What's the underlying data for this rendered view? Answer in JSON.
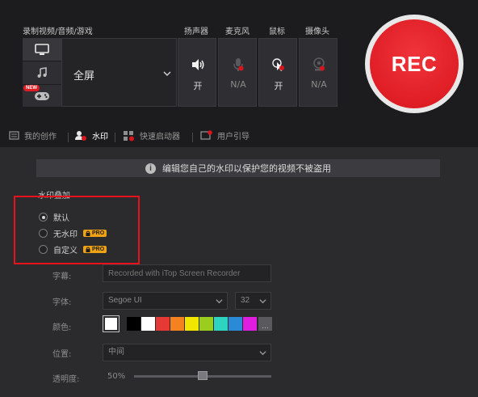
{
  "header": {
    "record_section_label": "录制视频/音频/游戏",
    "speaker_label": "扬声器",
    "mic_label": "麦克风",
    "mouse_label": "鼠标",
    "camera_label": "摄像头"
  },
  "sources": {
    "screen_mode": "全屏",
    "new_badge": "NEW"
  },
  "devices": {
    "speaker_state": "开",
    "mic_state": "N/A",
    "mouse_state": "开",
    "camera_state": "N/A"
  },
  "rec_button": "REC",
  "tabs": [
    {
      "label": "我的创作",
      "icon": "film-icon"
    },
    {
      "label": "水印",
      "icon": "watermark-icon"
    },
    {
      "label": "快速启动器",
      "icon": "launcher-icon"
    },
    {
      "label": "用户引导",
      "icon": "guide-icon"
    }
  ],
  "info_banner": "编辑您自己的水印以保护您的视频不被盗用",
  "watermark": {
    "group_title": "水印叠加",
    "options": [
      {
        "label": "默认",
        "selected": true,
        "pro": false
      },
      {
        "label": "无水印",
        "selected": false,
        "pro": true
      },
      {
        "label": "自定义",
        "selected": false,
        "pro": true
      }
    ],
    "pro_label": "PRO",
    "text_label": "字幕:",
    "text_placeholder": "Recorded with iTop Screen Recorder",
    "font_label": "字体:",
    "font_value": "Segoe UI",
    "size_value": "32",
    "color_label": "颜色:",
    "selected_color": "#ffffff",
    "palette": [
      "#000000",
      "#ffffff",
      "#e53935",
      "#f5821f",
      "#f2e600",
      "#9acd1e",
      "#2dd4c0",
      "#2a8ad8",
      "#e01ee0"
    ],
    "more_colors": "...",
    "position_label": "位置:",
    "position_value": "中间",
    "opacity_label": "透明度:",
    "opacity_value": "50%",
    "opacity_fraction": 0.5
  },
  "colors": {
    "rec_red": "#e01b24",
    "pro_orange": "#f0a215",
    "highlight_red": "#e8121d"
  }
}
